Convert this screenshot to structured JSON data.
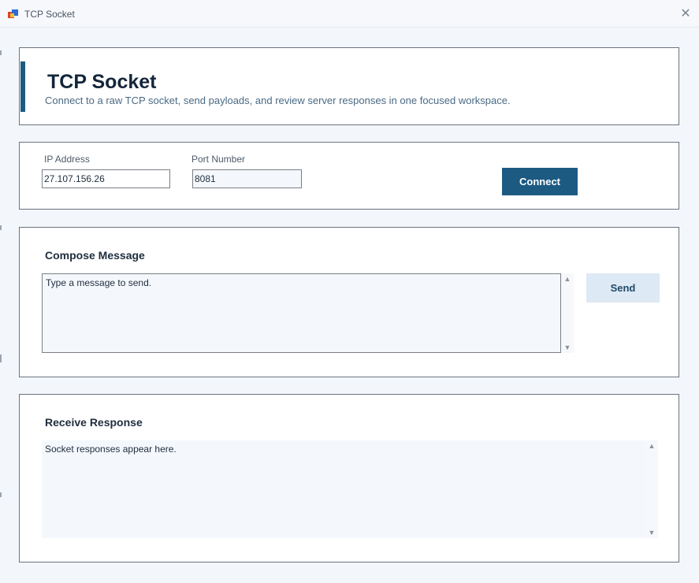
{
  "window": {
    "title": "TCP Socket",
    "close_icon": "close-icon"
  },
  "header": {
    "title": "TCP Socket",
    "subtitle": "Connect to a raw TCP socket, send payloads, and review server responses in one focused workspace."
  },
  "connection": {
    "ip_label": "IP Address",
    "ip_value": "27.107.156.26",
    "port_label": "Port Number",
    "port_value": "8081",
    "connect_label": "Connect"
  },
  "compose": {
    "title": "Compose Message",
    "message_value": "Type a message to send.",
    "send_label": "Send"
  },
  "receive": {
    "title": "Receive Response",
    "response_value": "Socket responses appear here."
  },
  "colors": {
    "accent": "#1c5a82",
    "send_button_bg": "#dde9f4",
    "panel_bg": "#ffffff",
    "window_bg": "#f3f7fb"
  }
}
